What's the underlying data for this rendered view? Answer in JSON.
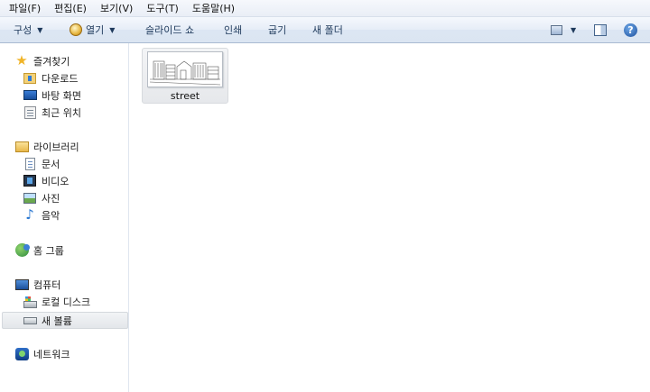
{
  "menubar": {
    "items": [
      "파일(F)",
      "편집(E)",
      "보기(V)",
      "도구(T)",
      "도움말(H)"
    ]
  },
  "toolbar": {
    "organize_label": "구성",
    "open_label": "열기",
    "slideshow_label": "슬라이드 쇼",
    "print_label": "인쇄",
    "burn_label": "굽기",
    "new_folder_label": "새 폴더",
    "help_glyph": "?"
  },
  "nav": {
    "favorites_label": "즐겨찾기",
    "downloads_label": "다운로드",
    "desktop_label": "바탕 화면",
    "recent_label": "최근 위치",
    "libraries_label": "라이브러리",
    "documents_label": "문서",
    "videos_label": "비디오",
    "pictures_label": "사진",
    "music_label": "음악",
    "homegroup_label": "홈 그룹",
    "computer_label": "컴퓨터",
    "local_disk_label": "로컬 디스크",
    "new_volume_label": "새 볼륨",
    "network_label": "네트워크"
  },
  "content": {
    "files": [
      {
        "name": "street",
        "selected": true
      }
    ]
  }
}
